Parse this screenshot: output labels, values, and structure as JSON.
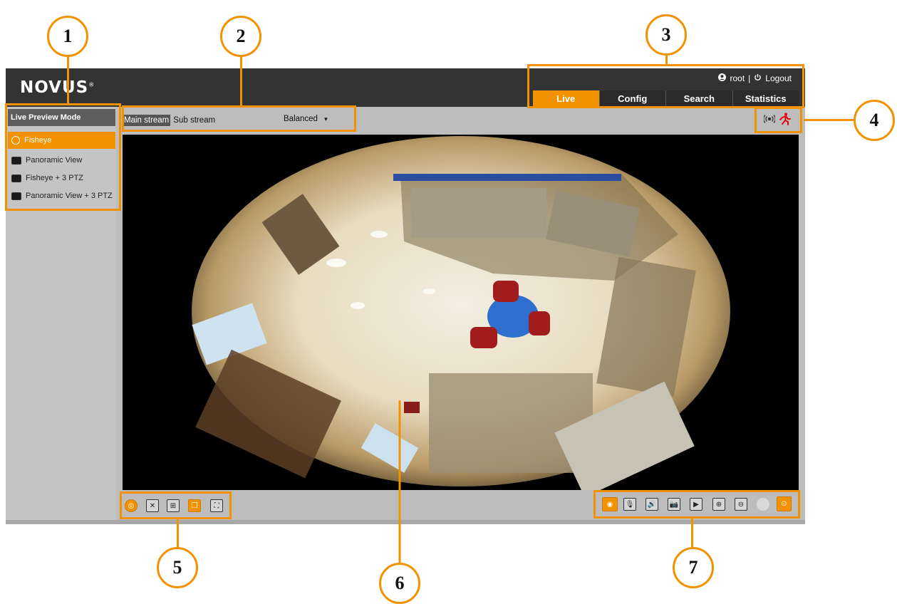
{
  "app": {
    "logo_text": "NOVUS",
    "logo_mark": "®"
  },
  "header": {
    "user_icon": "user-icon",
    "user": "root",
    "separator": "|",
    "logout_icon": "power-icon",
    "logout_label": "Logout",
    "tabs": [
      {
        "label": "Live",
        "active": true
      },
      {
        "label": "Config",
        "active": false
      },
      {
        "label": "Search",
        "active": false
      },
      {
        "label": "Statistics",
        "active": false
      }
    ]
  },
  "sidebar": {
    "title": "Live Preview Mode",
    "items": [
      {
        "label": "Fisheye",
        "active": true,
        "icon": "fisheye-icon"
      },
      {
        "label": "Panoramic View",
        "active": false,
        "icon": "panoramic-icon"
      },
      {
        "label": "Fisheye + 3 PTZ",
        "active": false,
        "icon": "fisheye-3ptz-icon"
      },
      {
        "label": "Panoramic View + 3 PTZ",
        "active": false,
        "icon": "panoramic-3ptz-icon"
      }
    ]
  },
  "stream": {
    "main_label": "Main stream",
    "sub_label": "Sub stream",
    "quality": "Balanced",
    "quality_caret": "▾"
  },
  "alarm_indicators": [
    "alarm-input-icon",
    "motion-detection-icon"
  ],
  "left_toolbar": [
    "fisheye-mode-icon",
    "close-all-icon",
    "fit-window-icon",
    "window-layout-icon",
    "fullscreen-icon"
  ],
  "right_toolbar": [
    "live-view-icon",
    "microphone-icon",
    "speaker-icon",
    "snapshot-icon",
    "record-icon",
    "zoom-in-icon",
    "zoom-out-icon",
    "ptz-disabled-icon",
    "ptz-control-icon"
  ],
  "callouts": [
    "1",
    "2",
    "3",
    "4",
    "5",
    "6",
    "7"
  ],
  "colors": {
    "accent": "#f39200",
    "header_bg": "#333333",
    "sidebar_bg": "#c4c4c4",
    "video_bg": "#000000"
  }
}
